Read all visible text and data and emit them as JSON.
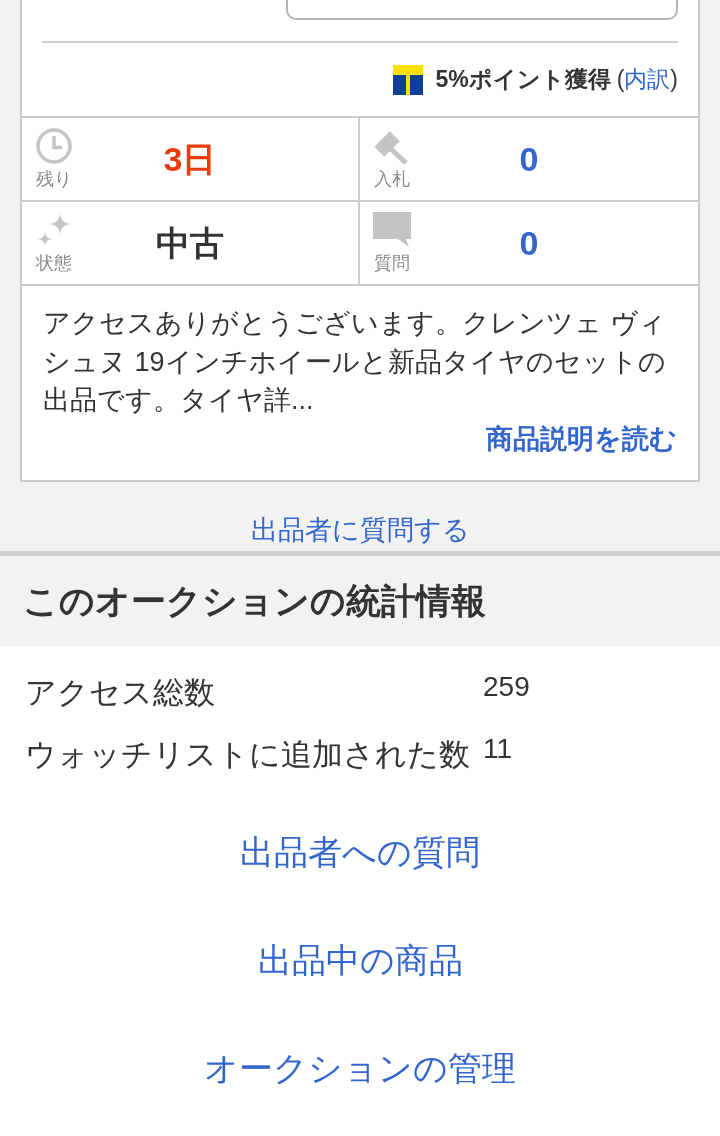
{
  "points": {
    "label": "5%ポイント獲得",
    "breakdown": {
      "open": "(",
      "link": "内訳",
      "close": ")"
    }
  },
  "summary": [
    {
      "kind": "remaining",
      "label": "残り",
      "value": "3日"
    },
    {
      "kind": "bids",
      "label": "入札",
      "value": "0"
    },
    {
      "kind": "condition",
      "label": "状態",
      "value": "中古"
    },
    {
      "kind": "questions",
      "label": "質問",
      "value": "0"
    }
  ],
  "description": {
    "text": "アクセスありがとうございます。クレンツェ ヴィシュヌ 19インチホイールと新品タイヤのセットの出品です。タイヤ詳...",
    "read_more": "商品説明を読む"
  },
  "ask_seller_link": "出品者に質問する",
  "statistics": {
    "title": "このオークションの統計情報",
    "rows": [
      {
        "label": "アクセス総数",
        "value": "259"
      },
      {
        "label": "ウォッチリストに追加された数",
        "value": "11"
      }
    ]
  },
  "links": [
    "出品者への質問",
    "出品中の商品",
    "オークションの管理"
  ]
}
